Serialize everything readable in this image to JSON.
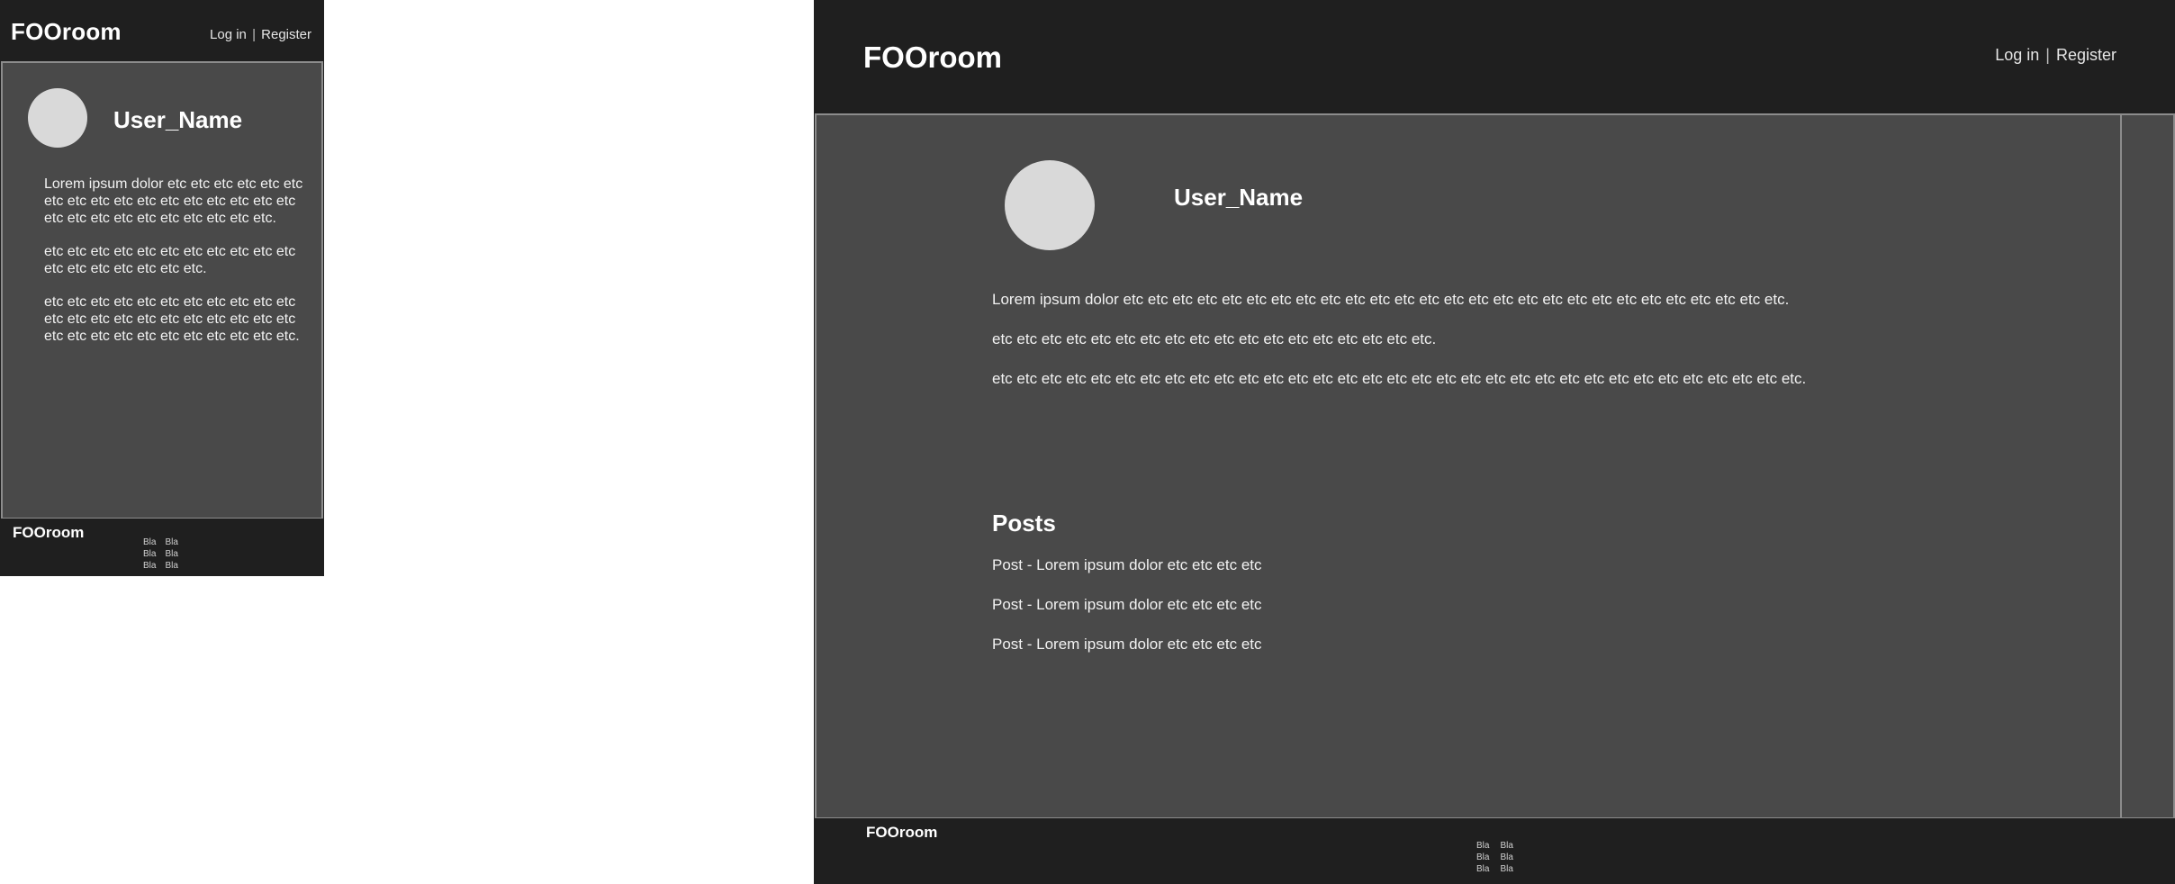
{
  "brand": "FOOroom",
  "nav": {
    "login": "Log in",
    "separator": "|",
    "register": "Register"
  },
  "profile": {
    "username": "User_Name",
    "bio": [
      "Lorem ipsum dolor etc etc etc etc etc etc etc etc etc etc etc etc etc etc etc etc etc etc etc etc etc etc etc etc etc etc etc.",
      "etc etc etc etc etc etc etc etc etc etc etc etc etc etc etc etc etc etc.",
      "etc etc etc etc etc etc etc etc etc etc etc etc etc etc etc etc etc etc etc etc etc etc etc etc etc etc etc etc etc etc etc etc etc."
    ]
  },
  "posts": {
    "title": "Posts",
    "items": [
      "Post - Lorem ipsum dolor etc etc etc etc",
      "Post - Lorem ipsum dolor etc etc etc etc",
      "Post - Lorem ipsum dolor etc etc etc etc"
    ]
  },
  "footer": {
    "brand": "FOOroom",
    "links": [
      "Bla",
      "Bla",
      "Bla",
      "Bla",
      "Bla",
      "Bla"
    ]
  },
  "colors": {
    "header_bg": "#1f1f1f",
    "main_bg": "#494949",
    "border": "#8c8c8c",
    "avatar": "#d9d9d9",
    "text": "#ffffff"
  }
}
